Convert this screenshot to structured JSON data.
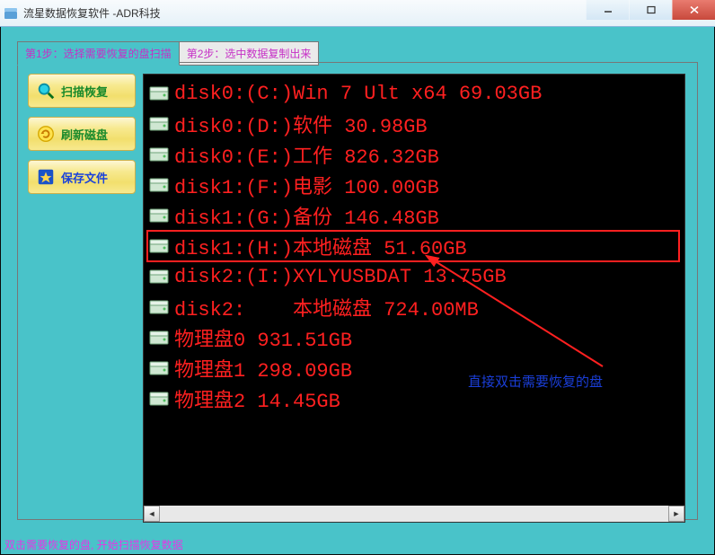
{
  "window": {
    "title": "流星数据恢复软件  -ADR科技"
  },
  "tabs": {
    "step1": "第1步：选择需要恢复的盘扫描",
    "step2": "第2步：选中数据复制出来"
  },
  "sidebar": {
    "scan": "扫描恢复",
    "refresh": "刷新磁盘",
    "save": "保存文件"
  },
  "disks": [
    {
      "label": "disk0:(C:)Win 7 Ult x64 69.03GB",
      "highlight": false
    },
    {
      "label": "disk0:(D:)软件 30.98GB",
      "highlight": false
    },
    {
      "label": "disk0:(E:)工作 826.32GB",
      "highlight": false
    },
    {
      "label": "disk1:(F:)电影 100.00GB",
      "highlight": false
    },
    {
      "label": "disk1:(G:)备份 146.48GB",
      "highlight": false
    },
    {
      "label": "disk1:(H:)本地磁盘 51.60GB",
      "highlight": true
    },
    {
      "label": "disk2:(I:)XYLYUSBDAT 13.75GB",
      "highlight": false
    },
    {
      "label": "disk2:    本地磁盘 724.00MB",
      "highlight": false
    },
    {
      "label": "物理盘0 931.51GB",
      "highlight": false
    },
    {
      "label": "物理盘1 298.09GB",
      "highlight": false
    },
    {
      "label": "物理盘2 14.45GB",
      "highlight": false
    }
  ],
  "annotation": "直接双击需要恢复的盘",
  "status": "双击需要恢复的盘, 开始扫描恢复数据",
  "colors": {
    "accent": "#49c3c9",
    "disktext": "#ff2020",
    "tabtext": "#c62fc6"
  }
}
